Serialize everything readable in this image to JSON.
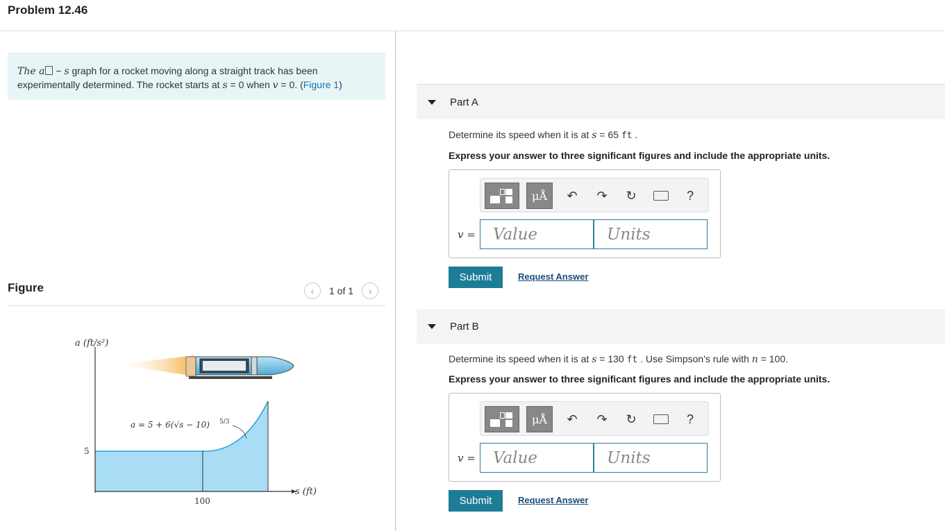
{
  "page": {
    "title": "Problem 12.46"
  },
  "problem": {
    "text_a": "The a",
    "text_b": " − ",
    "text_c": "s",
    "text_d": " graph for a rocket moving along a straight track has been experimentally determined. The rocket starts at ",
    "text_e": "s",
    "text_f": " = 0 when ",
    "text_g": "v",
    "text_h": " = 0. (",
    "figure_link": "Figure 1",
    "text_i": ")"
  },
  "figure": {
    "label": "Figure",
    "nav_text": "1 of 1",
    "y_axis_label": "a (ft/s²)",
    "x_axis_label": "s (ft)",
    "equation": "a = 5 + 6(√s − 10)",
    "equation_exp": "5/3",
    "y_tick": "5",
    "x_tick": "100"
  },
  "parts": [
    {
      "title": "Part A",
      "question_prefix": "Determine its speed when it is at ",
      "question_var": "s",
      "question_eq": " = 65 ",
      "question_unit": "ft",
      "question_suffix": " .",
      "instruction": "Express your answer to three significant figures and include the appropriate units.",
      "var_label": "v =",
      "value_placeholder": "Value",
      "units_placeholder": "Units",
      "submit": "Submit",
      "request": "Request Answer"
    },
    {
      "title": "Part B",
      "question_prefix": "Determine its speed when it is at ",
      "question_var": "s",
      "question_eq": " = 130 ",
      "question_unit": "ft",
      "question_suffix": " . Use Simpson's rule with ",
      "question_n": "n",
      "question_n_val": " = 100.",
      "instruction": "Express your answer to three significant figures and include the appropriate units.",
      "var_label": "v =",
      "value_placeholder": "Value",
      "units_placeholder": "Units",
      "submit": "Submit",
      "request": "Request Answer"
    }
  ],
  "toolbar": {
    "mu_label": "μÅ",
    "help_label": "?"
  }
}
